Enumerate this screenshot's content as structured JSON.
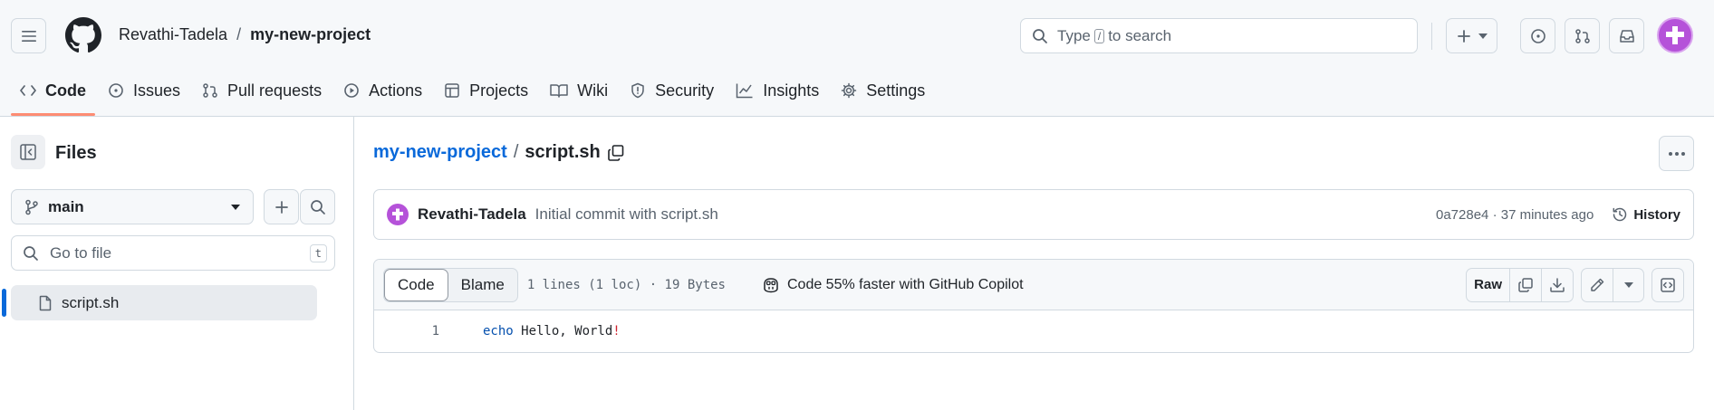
{
  "header": {
    "owner": "Revathi-Tadela",
    "separator": "/",
    "repo": "my-new-project",
    "search": {
      "prefix": "Type",
      "kbd": "/",
      "suffix": "to search"
    }
  },
  "tabs": [
    {
      "label": "Code",
      "icon": "code-icon",
      "active": true
    },
    {
      "label": "Issues",
      "icon": "issue-icon"
    },
    {
      "label": "Pull requests",
      "icon": "pull-request-icon"
    },
    {
      "label": "Actions",
      "icon": "play-icon"
    },
    {
      "label": "Projects",
      "icon": "table-icon"
    },
    {
      "label": "Wiki",
      "icon": "book-icon"
    },
    {
      "label": "Security",
      "icon": "shield-icon"
    },
    {
      "label": "Insights",
      "icon": "graph-icon"
    },
    {
      "label": "Settings",
      "icon": "gear-icon"
    }
  ],
  "sidebar": {
    "title": "Files",
    "branch": "main",
    "go_to_file": {
      "placeholder": "Go to file",
      "kbd": "t"
    },
    "tree": [
      {
        "name": "script.sh",
        "selected": true
      }
    ]
  },
  "file": {
    "repo_link": "my-new-project",
    "separator": "/",
    "name": "script.sh"
  },
  "commit": {
    "author": "Revathi-Tadela",
    "message": "Initial commit with script.sh",
    "hash": "0a728e4",
    "dot": "·",
    "time": "37 minutes ago",
    "history_label": "History"
  },
  "code_view": {
    "tab_code": "Code",
    "tab_blame": "Blame",
    "loc": "1 lines (1 loc) · 19 Bytes",
    "copilot": "Code 55% faster with GitHub Copilot",
    "raw_label": "Raw",
    "lines": [
      {
        "number": "1",
        "keyword": "echo",
        "text": " Hello, World",
        "punct": "!"
      }
    ]
  },
  "colors": {
    "accent": "#0969da",
    "active_tab_underline": "#fd8c73",
    "avatar": "#b552d9"
  }
}
